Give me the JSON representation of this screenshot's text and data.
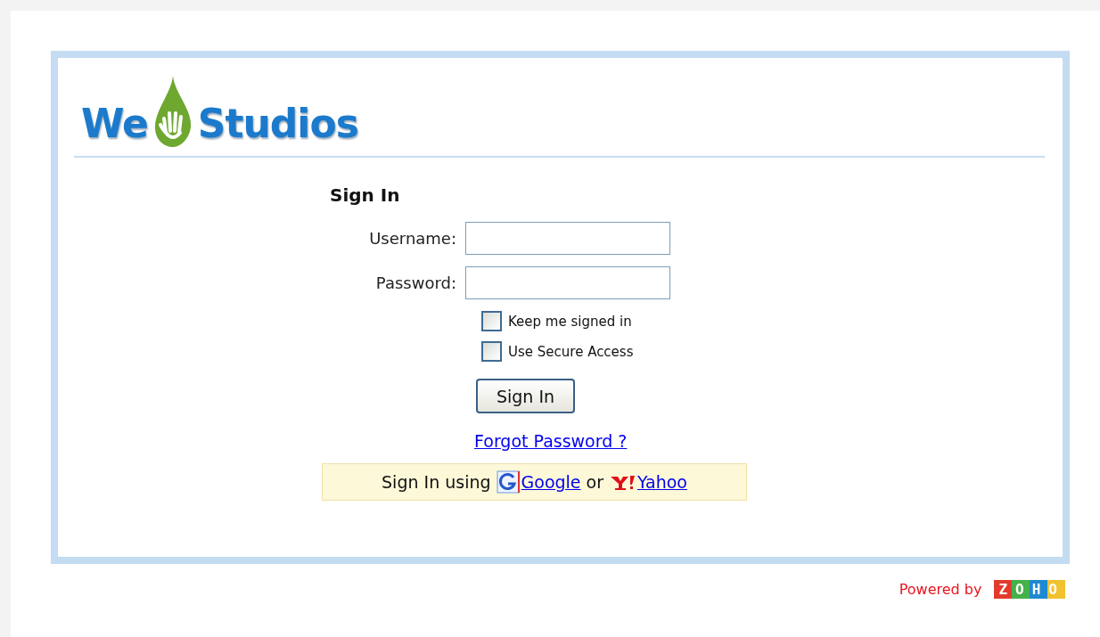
{
  "logo": {
    "left": "We",
    "right": "Studios"
  },
  "form": {
    "title": "Sign In",
    "fields": [
      {
        "label": "Username:"
      },
      {
        "label": "Password:"
      }
    ],
    "options": [
      {
        "label": "Keep me signed in",
        "checked": false
      },
      {
        "label": "Use Secure Access",
        "checked": false
      }
    ],
    "submit": "Sign In",
    "forgot_link": "Forgot Password ?",
    "alt_signin": {
      "prefix": "Sign In using",
      "providers": [
        {
          "name": "Google",
          "kind": "g"
        },
        {
          "name": "Yahoo",
          "kind": "y"
        }
      ],
      "joiner": "or"
    }
  },
  "footer": {
    "powered_by": "Powered by",
    "brand": "ZOHO"
  }
}
